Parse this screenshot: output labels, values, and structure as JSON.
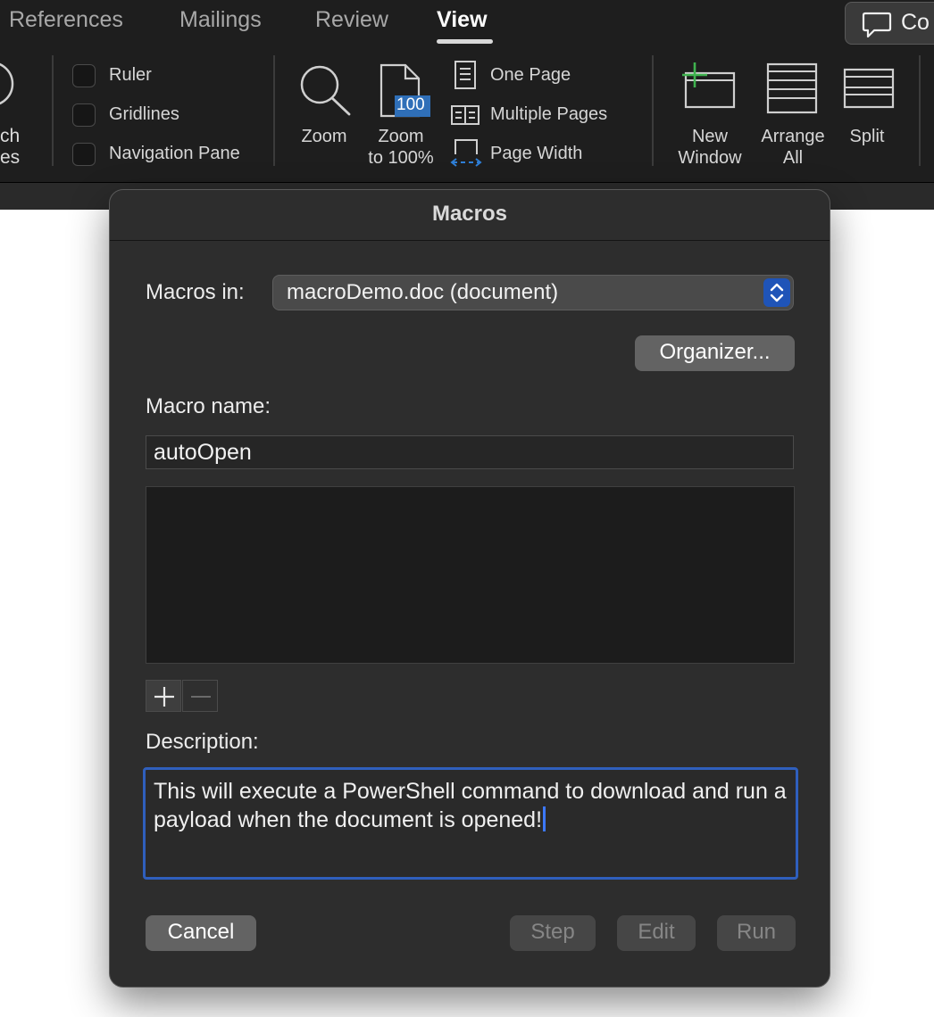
{
  "ribbon": {
    "tabs": [
      {
        "label": "References",
        "active": false
      },
      {
        "label": "Mailings",
        "active": false
      },
      {
        "label": "Review",
        "active": false
      },
      {
        "label": "View",
        "active": true
      }
    ],
    "comments_button_partial": "Co",
    "left_partial_labels": [
      "ch",
      "es"
    ],
    "show_options": [
      {
        "label": "Ruler",
        "checked": false
      },
      {
        "label": "Gridlines",
        "checked": false
      },
      {
        "label": "Navigation Pane",
        "checked": false
      }
    ],
    "zoom": {
      "zoom_label": "Zoom",
      "zoom100_line1": "Zoom",
      "zoom100_line2": "to 100%",
      "zoom100_badge": "100",
      "one_page": "One Page",
      "multiple_pages": "Multiple Pages",
      "page_width": "Page Width"
    },
    "window": {
      "new_window_line1": "New",
      "new_window_line2": "Window",
      "arrange_line1": "Arrange",
      "arrange_line2": "All",
      "split": "Split"
    },
    "colors": {
      "accent_green": "#3fb34f",
      "accent_blue": "#2f7fd6"
    }
  },
  "dialog": {
    "title": "Macros",
    "macros_in_label": "Macros in:",
    "macros_in_value": "macroDemo.doc (document)",
    "organizer_label": "Organizer...",
    "macro_name_label": "Macro name:",
    "macro_name_value": "autoOpen",
    "macro_list": [],
    "description_label": "Description:",
    "description_text": "This will execute a PowerShell command to download and run a payload when the document is opened!",
    "buttons": {
      "cancel": "Cancel",
      "step": "Step",
      "edit": "Edit",
      "run": "Run"
    },
    "colors": {
      "focus_ring": "#2f5fbd",
      "stepper": "#1f54b8"
    }
  }
}
